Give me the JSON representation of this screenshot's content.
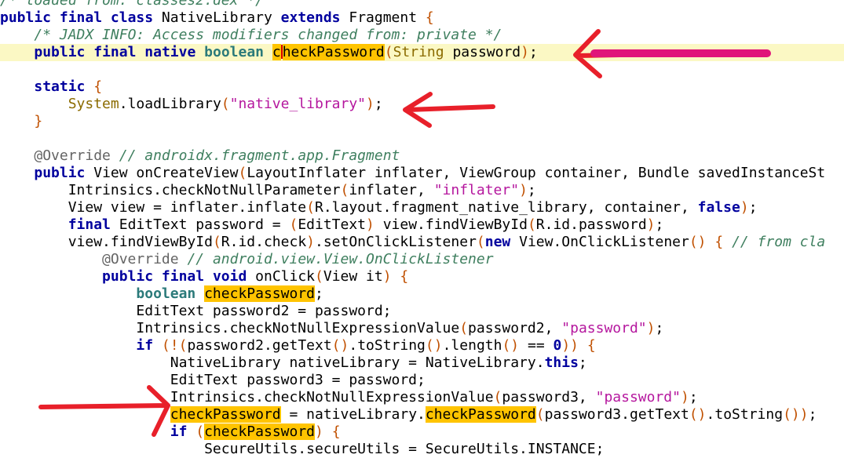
{
  "editor": {
    "language": "java",
    "colors": {
      "current_line": "#fbf8c4",
      "highlight": "#ffc400",
      "annotation_arrows": "#e8202a",
      "annotation_bar": "#e0157a"
    },
    "lines": [
      [
        [
          "comment",
          "/* loaded from: classes2.dex */"
        ]
      ],
      [
        [
          "kw",
          "public"
        ],
        [
          "p",
          " "
        ],
        [
          "kw",
          "final"
        ],
        [
          "p",
          " "
        ],
        [
          "kw",
          "class"
        ],
        [
          "p",
          " NativeLibrary "
        ],
        [
          "kw",
          "extends"
        ],
        [
          "p",
          " Fragment "
        ],
        [
          "paren",
          "{"
        ]
      ],
      [
        [
          "p",
          "    "
        ],
        [
          "comment",
          "/* JADX INFO: Access modifiers changed from: private */"
        ]
      ],
      [
        [
          "p",
          "    "
        ],
        [
          "kw",
          "public"
        ],
        [
          "p",
          " "
        ],
        [
          "kw",
          "final"
        ],
        [
          "p",
          " "
        ],
        [
          "kw",
          "native"
        ],
        [
          "p",
          " "
        ],
        [
          "type",
          "boolean"
        ],
        [
          "p",
          " "
        ],
        [
          "hl",
          "c"
        ],
        [
          "caret",
          ""
        ],
        [
          "hl",
          "heckPassword"
        ],
        [
          "paren",
          "("
        ],
        [
          "class",
          "String"
        ],
        [
          "p",
          " password"
        ],
        [
          "paren",
          ")"
        ],
        [
          "p",
          ";"
        ]
      ],
      [
        [
          "p",
          ""
        ]
      ],
      [
        [
          "p",
          "    "
        ],
        [
          "kw",
          "static"
        ],
        [
          "p",
          " "
        ],
        [
          "paren",
          "{"
        ]
      ],
      [
        [
          "p",
          "        "
        ],
        [
          "class",
          "System"
        ],
        [
          "p",
          ".loadLibrary"
        ],
        [
          "paren",
          "("
        ],
        [
          "str",
          "\"native_library\""
        ],
        [
          "paren",
          ")"
        ],
        [
          "p",
          ";"
        ]
      ],
      [
        [
          "p",
          "    "
        ],
        [
          "paren",
          "}"
        ]
      ],
      [
        [
          "p",
          ""
        ]
      ],
      [
        [
          "p",
          "    "
        ],
        [
          "anno",
          "@Override"
        ],
        [
          "p",
          " "
        ],
        [
          "comment",
          "// androidx.fragment.app.Fragment"
        ]
      ],
      [
        [
          "p",
          "    "
        ],
        [
          "kw",
          "public"
        ],
        [
          "p",
          " View onCreateView"
        ],
        [
          "paren",
          "("
        ],
        [
          "p",
          "LayoutInflater inflater, ViewGroup container, Bundle savedInstanceSt"
        ]
      ],
      [
        [
          "p",
          "        Intrinsics.checkNotNullParameter"
        ],
        [
          "paren",
          "("
        ],
        [
          "p",
          "inflater, "
        ],
        [
          "str",
          "\"inflater\""
        ],
        [
          "paren",
          ")"
        ],
        [
          "p",
          ";"
        ]
      ],
      [
        [
          "p",
          "        View view = inflater.inflate"
        ],
        [
          "paren",
          "("
        ],
        [
          "p",
          "R.layout.fragment_native_library, container, "
        ],
        [
          "kw",
          "false"
        ],
        [
          "paren",
          ")"
        ],
        [
          "p",
          ";"
        ]
      ],
      [
        [
          "p",
          "        "
        ],
        [
          "kw",
          "final"
        ],
        [
          "p",
          " EditText password = "
        ],
        [
          "paren",
          "("
        ],
        [
          "p",
          "EditText"
        ],
        [
          "paren",
          ")"
        ],
        [
          "p",
          " view.findViewById"
        ],
        [
          "paren",
          "("
        ],
        [
          "p",
          "R.id.password"
        ],
        [
          "paren",
          ")"
        ],
        [
          "p",
          ";"
        ]
      ],
      [
        [
          "p",
          "        view.findViewById"
        ],
        [
          "paren",
          "("
        ],
        [
          "p",
          "R.id.check"
        ],
        [
          "paren",
          ")"
        ],
        [
          "p",
          ".setOnClickListener"
        ],
        [
          "paren",
          "("
        ],
        [
          "kw",
          "new"
        ],
        [
          "p",
          " View.OnClickListener"
        ],
        [
          "paren",
          "()"
        ],
        [
          "p",
          " "
        ],
        [
          "paren",
          "{"
        ],
        [
          "p",
          " "
        ],
        [
          "comment",
          "// from cla"
        ]
      ],
      [
        [
          "p",
          "            "
        ],
        [
          "anno",
          "@Override"
        ],
        [
          "p",
          " "
        ],
        [
          "comment",
          "// android.view.View.OnClickListener"
        ]
      ],
      [
        [
          "p",
          "            "
        ],
        [
          "kw",
          "public"
        ],
        [
          "p",
          " "
        ],
        [
          "kw",
          "final"
        ],
        [
          "p",
          " "
        ],
        [
          "kw",
          "void"
        ],
        [
          "p",
          " onClick"
        ],
        [
          "paren",
          "("
        ],
        [
          "p",
          "View it"
        ],
        [
          "paren",
          ")"
        ],
        [
          "p",
          " "
        ],
        [
          "paren",
          "{"
        ]
      ],
      [
        [
          "p",
          "                "
        ],
        [
          "type",
          "boolean"
        ],
        [
          "p",
          " "
        ],
        [
          "hl",
          "checkPassword"
        ],
        [
          "p",
          ";"
        ]
      ],
      [
        [
          "p",
          "                EditText password2 = password;"
        ]
      ],
      [
        [
          "p",
          "                Intrinsics.checkNotNullExpressionValue"
        ],
        [
          "paren",
          "("
        ],
        [
          "p",
          "password2, "
        ],
        [
          "str",
          "\"password\""
        ],
        [
          "paren",
          ")"
        ],
        [
          "p",
          ";"
        ]
      ],
      [
        [
          "p",
          "                "
        ],
        [
          "kw",
          "if"
        ],
        [
          "p",
          " "
        ],
        [
          "paren",
          "(!("
        ],
        [
          "p",
          "password2.getText"
        ],
        [
          "paren",
          "()"
        ],
        [
          "p",
          ".toString"
        ],
        [
          "paren",
          "()"
        ],
        [
          "p",
          ".length"
        ],
        [
          "paren",
          "()"
        ],
        [
          "p",
          " == "
        ],
        [
          "kw",
          "0"
        ],
        [
          "paren",
          "))"
        ],
        [
          "p",
          " "
        ],
        [
          "paren",
          "{"
        ]
      ],
      [
        [
          "p",
          "                    NativeLibrary nativeLibrary = NativeLibrary."
        ],
        [
          "kw",
          "this"
        ],
        [
          "p",
          ";"
        ]
      ],
      [
        [
          "p",
          "                    EditText password3 = password;"
        ]
      ],
      [
        [
          "p",
          "                    Intrinsics.checkNotNullExpressionValue"
        ],
        [
          "paren",
          "("
        ],
        [
          "p",
          "password3, "
        ],
        [
          "str",
          "\"password\""
        ],
        [
          "paren",
          ")"
        ],
        [
          "p",
          ";"
        ]
      ],
      [
        [
          "p",
          "                    "
        ],
        [
          "hl",
          "checkPassword"
        ],
        [
          "p",
          " = nativeLibrary."
        ],
        [
          "hl",
          "checkPassword"
        ],
        [
          "paren",
          "("
        ],
        [
          "p",
          "password3.getText"
        ],
        [
          "paren",
          "()"
        ],
        [
          "p",
          ".toString"
        ],
        [
          "paren",
          "())"
        ],
        [
          "p",
          ";"
        ]
      ],
      [
        [
          "p",
          "                    "
        ],
        [
          "kw",
          "if"
        ],
        [
          "p",
          " "
        ],
        [
          "paren",
          "("
        ],
        [
          "hl",
          "checkPassword"
        ],
        [
          "paren",
          ")"
        ],
        [
          "p",
          " "
        ],
        [
          "paren",
          "{"
        ]
      ],
      [
        [
          "p",
          "                        SecureUtils.secureUtils = SecureUtils.INSTANCE;"
        ]
      ]
    ],
    "current_line_index": 3
  }
}
